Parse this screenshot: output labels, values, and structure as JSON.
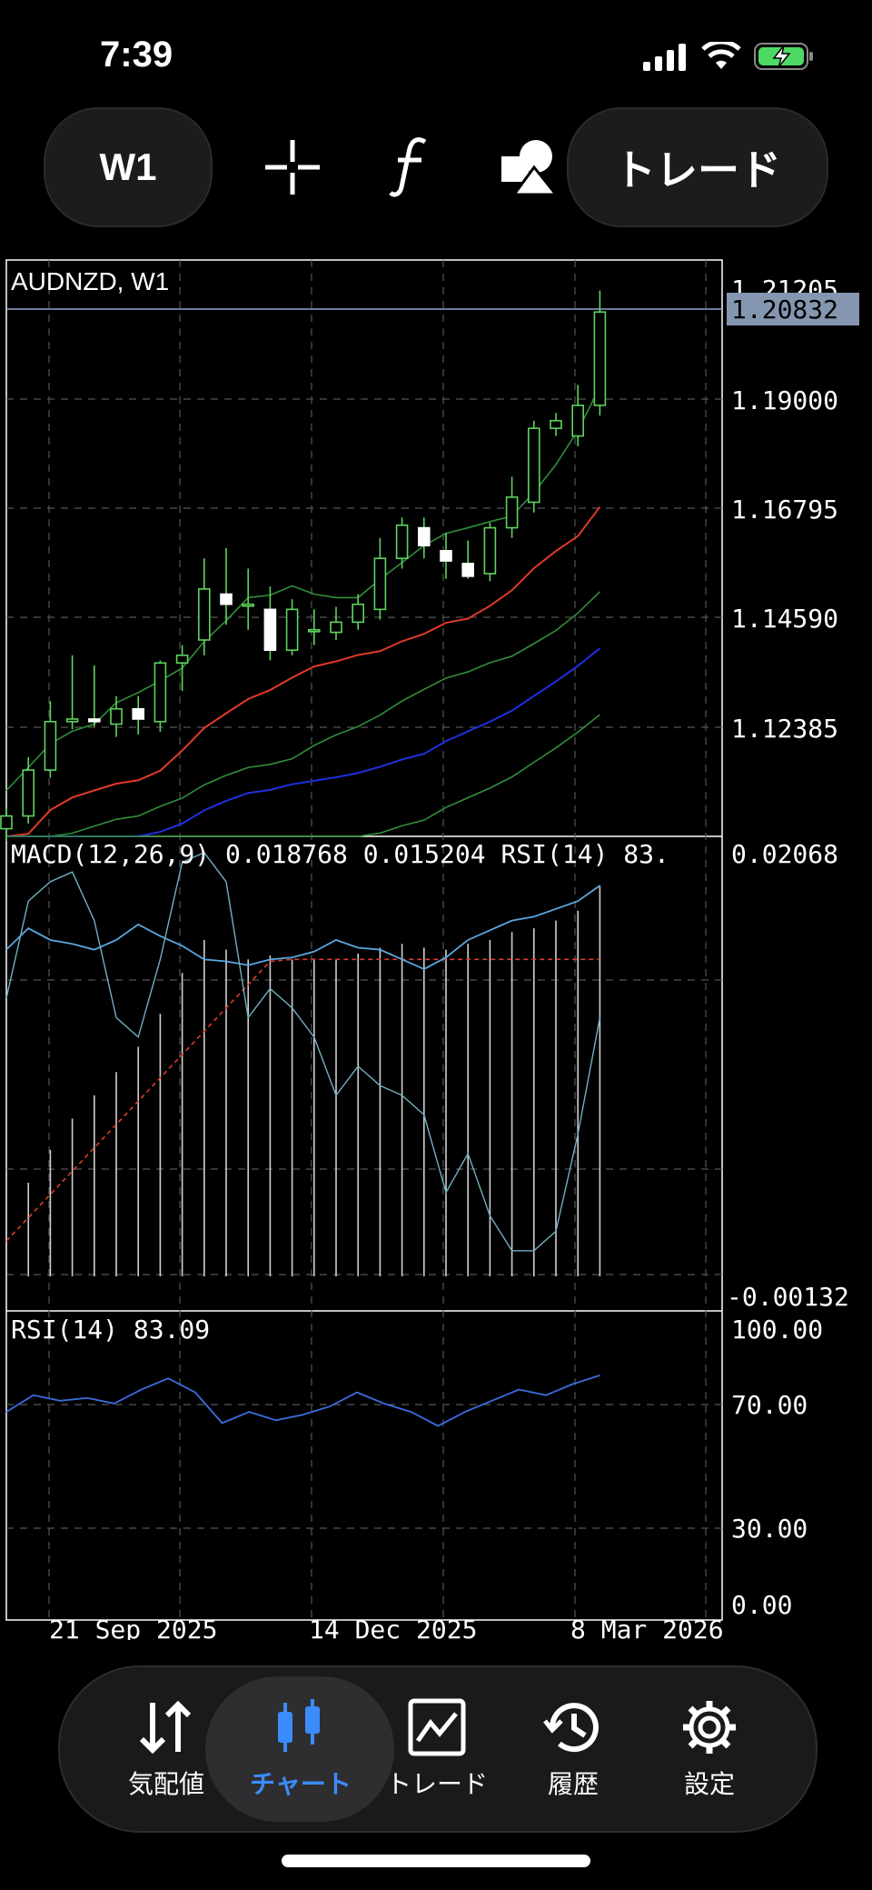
{
  "status": {
    "time": "7:39"
  },
  "toolbar": {
    "timeframe": "W1",
    "trade_label": "トレード",
    "icons": [
      "crosshair-icon",
      "function-icon",
      "objects-icon"
    ]
  },
  "chart": {
    "symbol_label": "AUDNZD, W1",
    "price_levels": [
      "1.21205",
      "1.19000",
      "1.16795",
      "1.14590",
      "1.12385"
    ],
    "current_price": "1.20832",
    "macd_label": "MACD(12,26,9) 0.018768 0.015204 RSI(14) 83.",
    "macd_levels": [
      "0.02068",
      "-0.00132"
    ],
    "rsi_label": "RSI(14) 83.09",
    "rsi_levels": [
      "100.00",
      "70.00",
      "30.00",
      "0.00"
    ],
    "dates": [
      "21 Sep 2025",
      "14 Dec 2025",
      "8 Mar 2026"
    ],
    "colors": {
      "up": "#5fd35f",
      "down": "#ffffff",
      "ma_red": "#e03a2a",
      "ma_blue": "#1f2fe0",
      "band": "#2f8f3a",
      "macd_line": "#5aa7e0",
      "signal": "#e03a2a",
      "rsi": "#3b6de0"
    }
  },
  "chart_data": [
    {
      "type": "candlestick",
      "title": "AUDNZD, W1",
      "ylim": [
        1.1055,
        1.2185
      ],
      "candles": [
        {
          "o": 1.107,
          "h": 1.111,
          "l": 1.1045,
          "c": 1.1095
        },
        {
          "o": 1.1095,
          "h": 1.121,
          "l": 1.108,
          "c": 1.1185
        },
        {
          "o": 1.1185,
          "h": 1.132,
          "l": 1.117,
          "c": 1.128
        },
        {
          "o": 1.128,
          "h": 1.141,
          "l": 1.1265,
          "c": 1.1285
        },
        {
          "o": 1.1285,
          "h": 1.139,
          "l": 1.127,
          "c": 1.128
        },
        {
          "o": 1.1275,
          "h": 1.133,
          "l": 1.125,
          "c": 1.1305
        },
        {
          "o": 1.1305,
          "h": 1.133,
          "l": 1.1255,
          "c": 1.1285
        },
        {
          "o": 1.128,
          "h": 1.14,
          "l": 1.126,
          "c": 1.1395
        },
        {
          "o": 1.1395,
          "h": 1.143,
          "l": 1.134,
          "c": 1.141
        },
        {
          "o": 1.144,
          "h": 1.16,
          "l": 1.141,
          "c": 1.154
        },
        {
          "o": 1.153,
          "h": 1.162,
          "l": 1.147,
          "c": 1.151
        },
        {
          "o": 1.151,
          "h": 1.158,
          "l": 1.146,
          "c": 1.151
        },
        {
          "o": 1.15,
          "h": 1.1545,
          "l": 1.14,
          "c": 1.142
        },
        {
          "o": 1.142,
          "h": 1.152,
          "l": 1.141,
          "c": 1.15
        },
        {
          "o": 1.146,
          "h": 1.15,
          "l": 1.143,
          "c": 1.146
        },
        {
          "o": 1.1455,
          "h": 1.1505,
          "l": 1.144,
          "c": 1.1475
        },
        {
          "o": 1.1475,
          "h": 1.153,
          "l": 1.146,
          "c": 1.151
        },
        {
          "o": 1.15,
          "h": 1.164,
          "l": 1.148,
          "c": 1.16
        },
        {
          "o": 1.16,
          "h": 1.168,
          "l": 1.158,
          "c": 1.1665
        },
        {
          "o": 1.166,
          "h": 1.168,
          "l": 1.16,
          "c": 1.1625
        },
        {
          "o": 1.1615,
          "h": 1.165,
          "l": 1.156,
          "c": 1.1595
        },
        {
          "o": 1.159,
          "h": 1.1635,
          "l": 1.156,
          "c": 1.1565
        },
        {
          "o": 1.157,
          "h": 1.167,
          "l": 1.1555,
          "c": 1.166
        },
        {
          "o": 1.166,
          "h": 1.176,
          "l": 1.164,
          "c": 1.172
        },
        {
          "o": 1.171,
          "h": 1.187,
          "l": 1.169,
          "c": 1.1855
        },
        {
          "o": 1.1855,
          "h": 1.1885,
          "l": 1.184,
          "c": 1.187
        },
        {
          "o": 1.184,
          "h": 1.194,
          "l": 1.182,
          "c": 1.19
        },
        {
          "o": 1.19,
          "h": 1.2125,
          "l": 1.188,
          "c": 1.2083
        }
      ]
    },
    {
      "type": "line",
      "title": "MACD(12,26,9)",
      "ylim": [
        -0.00132,
        0.02068
      ],
      "values": [
        0.0155,
        0.0166,
        0.016,
        0.0158,
        0.0155,
        0.016,
        0.0168,
        0.0162,
        0.0157,
        0.015,
        0.0149,
        0.0147,
        0.015,
        0.0151,
        0.0154,
        0.016,
        0.0156,
        0.0155,
        0.015,
        0.0145,
        0.0151,
        0.016,
        0.0165,
        0.017,
        0.0172,
        0.0176,
        0.018,
        0.0188
      ]
    },
    {
      "type": "line",
      "title": "RSI(14) 83.09",
      "ylim": [
        0,
        100
      ],
      "values": [
        70,
        76,
        74,
        75,
        73,
        78,
        82,
        77,
        66,
        70,
        67,
        69,
        72,
        77,
        73,
        70,
        65,
        70,
        74,
        78,
        76,
        80,
        83.09
      ]
    }
  ]
}
